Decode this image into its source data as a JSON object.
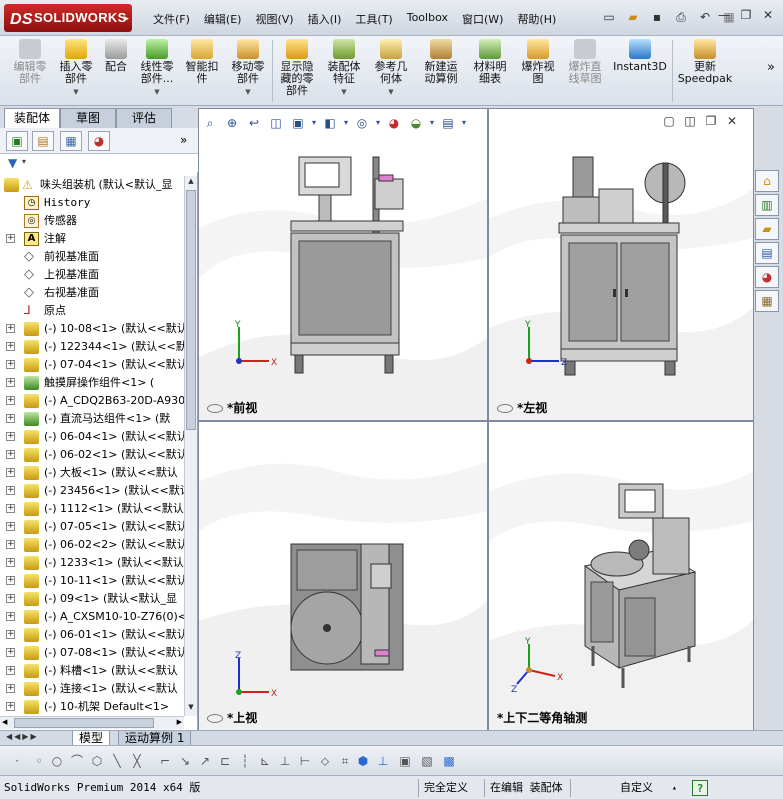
{
  "app": {
    "name": "SOLIDWORKS",
    "logo_mark": "DS"
  },
  "menubar": [
    "文件(F)",
    "编辑(E)",
    "视图(V)",
    "插入(I)",
    "工具(T)",
    "Toolbox",
    "窗口(W)",
    "帮助(H)"
  ],
  "quick_access_icons": [
    "new-document-icon",
    "open-folder-icon",
    "save-icon",
    "print-icon",
    "undo-icon",
    "rebuild-icon"
  ],
  "window_controls": [
    "minimize",
    "restore",
    "close"
  ],
  "commands": [
    {
      "label": "编辑零\n部件",
      "enabled": false
    },
    {
      "label": "插入零\n部件",
      "enabled": true
    },
    {
      "label": "配合",
      "enabled": true
    },
    {
      "label": "线性零\n部件...",
      "enabled": true
    },
    {
      "label": "智能扣\n件",
      "enabled": true
    },
    {
      "label": "移动零\n部件",
      "enabled": true
    },
    {
      "label": "显示隐\n藏的零\n部件",
      "enabled": true
    },
    {
      "label": "装配体\n特征",
      "enabled": true
    },
    {
      "label": "参考几\n何体",
      "enabled": true
    },
    {
      "label": "新建运\n动算例",
      "enabled": true
    },
    {
      "label": "材料明\n细表",
      "enabled": true
    },
    {
      "label": "爆炸视\n图",
      "enabled": true
    },
    {
      "label": "爆炸直\n线草图",
      "enabled": false
    },
    {
      "label": "Instant3D",
      "enabled": true
    },
    {
      "label": "更新\nSpeedpak",
      "enabled": true
    }
  ],
  "feature_manager": {
    "tabs": [
      "装配体",
      "草图",
      "评估"
    ],
    "root": "味头组装机  (默认<默认_显",
    "fixed_items": [
      {
        "label": "History",
        "icon": "history-icon"
      },
      {
        "label": "传感器",
        "icon": "sensor-icon"
      },
      {
        "label": "注解",
        "icon": "annotation-icon"
      },
      {
        "label": "前视基准面",
        "icon": "plane-icon"
      },
      {
        "label": "上视基准面",
        "icon": "plane-icon"
      },
      {
        "label": "右视基准面",
        "icon": "plane-icon"
      },
      {
        "label": "原点",
        "icon": "origin-icon"
      }
    ],
    "components": [
      "(-) 10-08<1> (默认<<默认",
      "(-) 122344<1> (默认<<默",
      "(-) 07-04<1> (默认<<默认",
      "触摸屏操作组件<1> (",
      "(-) A_CDQ2B63-20D-A930<",
      "(-) 直流马达组件<1> (默",
      "(-) 06-04<1> (默认<<默认",
      "(-) 06-02<1> (默认<<默认",
      "(-) 大板<1> (默认<<默认",
      "(-) 23456<1> (默认<<默认",
      "(-) 1112<1> (默认<<默认",
      "(-) 07-05<1> (默认<<默认",
      "(-) 06-02<2> (默认<<默认",
      "(-) 1233<1> (默认<<默认",
      "(-) 10-11<1> (默认<<默认",
      "(-) 09<1> (默认<默认_显",
      "(-) A_CXSM10-10-Z76(0)<",
      "(-) 06-01<1> (默认<<默认",
      "(-) 07-08<1> (默认<<默认",
      "(-) 料槽<1> (默认<<默认",
      "(-) 连接<1> (默认<<默认",
      "(-) 10-机架 Default<1>"
    ]
  },
  "viewports": [
    {
      "label": "*前视"
    },
    {
      "label": "*左视"
    },
    {
      "label": "*上视"
    },
    {
      "label": "*上下二等角轴测"
    }
  ],
  "axes": {
    "x": "X",
    "y": "Y",
    "z": "Z"
  },
  "bottom_tabs": [
    "模型",
    "运动算例 1"
  ],
  "status": {
    "product": "SolidWorks Premium 2014 x64 版",
    "definition": "完全定义",
    "mode": "在编辑 装配体",
    "units": "自定义",
    "help": "?"
  }
}
